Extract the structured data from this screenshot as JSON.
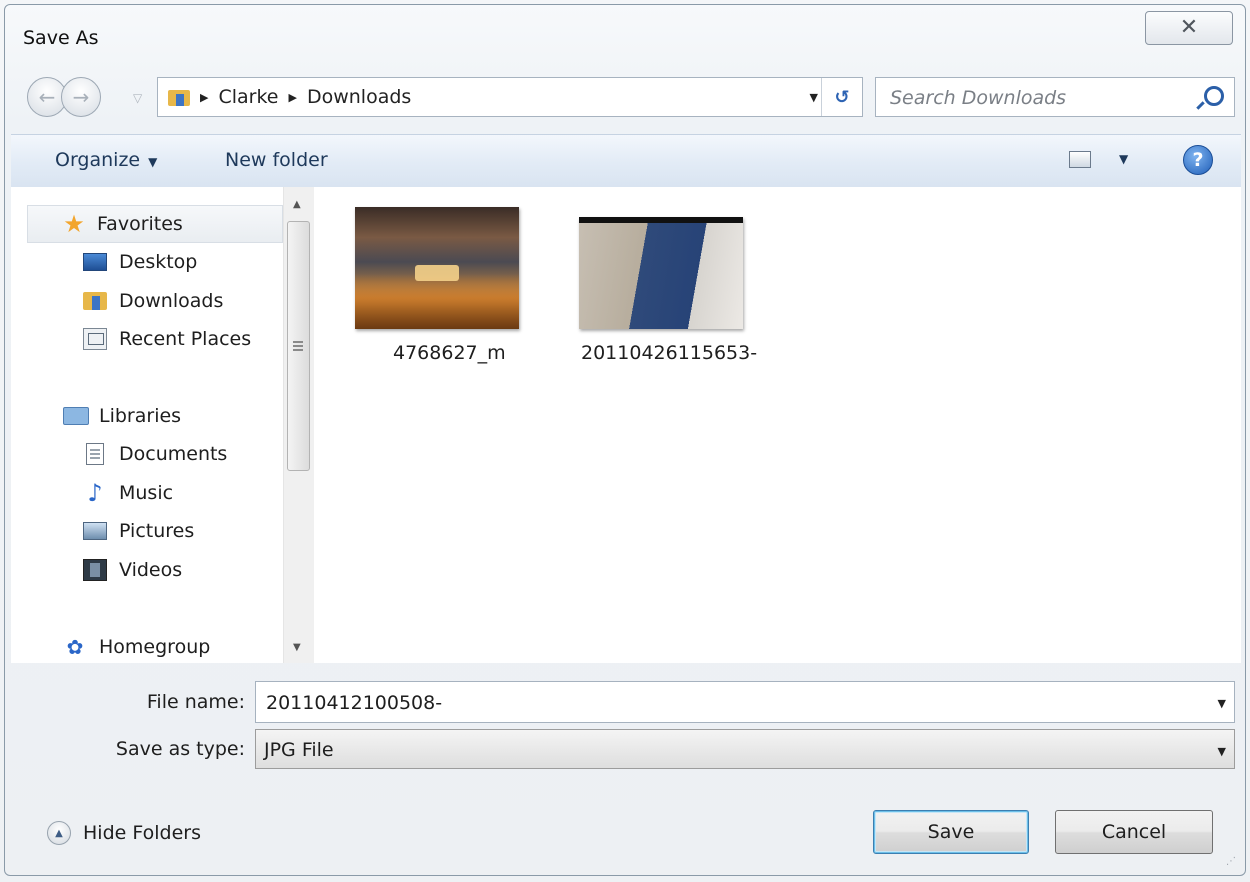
{
  "window": {
    "title": "Save As",
    "close_symbol": "☒"
  },
  "address": {
    "crumbs": [
      "Clarke",
      "Downloads"
    ],
    "search_placeholder": "Search Downloads"
  },
  "toolbar": {
    "organize": "Organize",
    "new_folder": "New folder",
    "help": "?"
  },
  "sidebar": {
    "favorites": "Favorites",
    "favorite_items": [
      "Desktop",
      "Downloads",
      "Recent Places"
    ],
    "libraries": "Libraries",
    "library_items": [
      "Documents",
      "Music",
      "Pictures",
      "Videos"
    ],
    "homegroup": "Homegroup"
  },
  "files": [
    {
      "name": "4768627_m"
    },
    {
      "name": "20110426115653-"
    }
  ],
  "form": {
    "file_name_label": "File name:",
    "file_name_value": "20110412100508-",
    "save_type_label": "Save as type:",
    "save_type_value": "JPG File"
  },
  "footer": {
    "hide_folders": "Hide Folders",
    "save": "Save",
    "cancel": "Cancel"
  }
}
